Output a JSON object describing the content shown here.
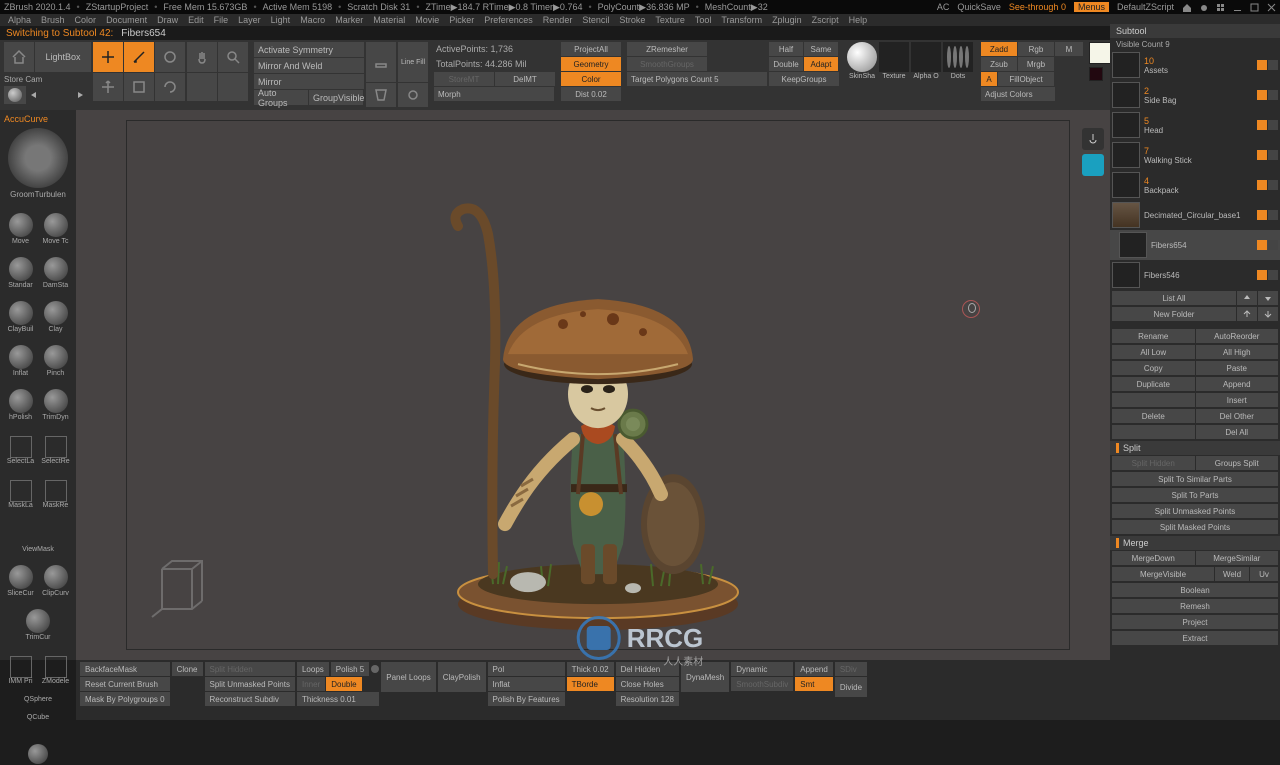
{
  "title": {
    "app": "ZBrush 2020.1.4",
    "project": "ZStartupProject",
    "freemem": "Free Mem 15.673GB",
    "activemem": "Active Mem 5198",
    "scratch": "Scratch Disk 31",
    "ztime": "ZTime▶184.7 RTime▶0.8 Timer▶0.764",
    "polycount": "PolyCount▶36.836 MP",
    "meshcount": "MeshCount▶32",
    "ac": "AC",
    "quicksave": "QuickSave",
    "seethrough": "See-through  0",
    "menus": "Menus",
    "script": "DefaultZScript"
  },
  "menu": {
    "items": [
      "Alpha",
      "Brush",
      "Color",
      "Document",
      "Draw",
      "Edit",
      "File",
      "Layer",
      "Light",
      "Macro",
      "Marker",
      "Material",
      "Movie",
      "Picker",
      "Preferences",
      "Render",
      "Stencil",
      "Stroke",
      "Texture",
      "Tool",
      "Transform",
      "Zplugin",
      "Zscript",
      "Help"
    ]
  },
  "status": {
    "msg": "Switching to Subtool 42:",
    "val": "Fibers654"
  },
  "toolbar": {
    "lightbox": "LightBox",
    "store": "Store Cam",
    "activate_sym": "Activate Symmetry",
    "mirror_weld": "Mirror And Weld",
    "mirror": "Mirror",
    "auto_groups": "Auto Groups",
    "group_visible": "GroupVisible",
    "activepoints": "ActivePoints: 1,736",
    "totalpoints": "TotalPoints: 44.286 Mil",
    "storemt": "StoreMT",
    "delmt": "DelMT",
    "morph": "Morph",
    "project_all": "ProjectAll",
    "geometry": "Geometry",
    "color": "Color",
    "dist": "Dist 0.02",
    "zremesher": "ZRemesher",
    "smoothgroups": "SmoothGroups",
    "target_poly": "Target Polygons Count 5",
    "hhalf": "Half",
    "hsame": "Same",
    "hdouble": "Double",
    "hadapt": "Adapt",
    "keepgroups": "KeepGroups",
    "zadd": "Zadd",
    "zsub": "Zsub",
    "rgb": "Rgb",
    "mrgb": "Mrgb",
    "m": "M",
    "a": "A",
    "fillobject": "FillObject",
    "adjust_colors": "Adjust Colors",
    "skinsha": "SkinSha",
    "texture": "Texture",
    "alphao": "Alpha O",
    "dots": "Dots"
  },
  "left_tools": [
    "Move",
    "Scale",
    "Rotate",
    "Actual"
  ],
  "left": {
    "accu": "AccuCurve",
    "bigbrush": "GroomTurbulen",
    "brushes": [
      "Move",
      "Move Tc",
      "Standar",
      "DamSta",
      "ClayBuil",
      "Clay",
      "Inflat",
      "Pinch",
      "hPolish",
      "TrimDyn",
      "SelectLa",
      "SelectRe",
      "MaskLa",
      "MaskRe",
      "ViewMask",
      "SliceCur",
      "ClipCurv",
      "TrimCur",
      "IMM Pri",
      "ZModele",
      "QSphere",
      "QCube"
    ]
  },
  "right": {
    "subtool": "Subtool",
    "visible": "Visible Count 9",
    "items": [
      {
        "n": "10",
        "name": "Assets"
      },
      {
        "n": "2",
        "name": "Side Bag"
      },
      {
        "n": "5",
        "name": "Head"
      },
      {
        "n": "7",
        "name": "Walking Stick"
      },
      {
        "n": "4",
        "name": "Backpack"
      },
      {
        "n": "",
        "name": "Decimated_Circular_base1"
      },
      {
        "n": "",
        "name": "Fibers654"
      },
      {
        "n": "",
        "name": "Fibers546"
      }
    ],
    "list_all": "List All",
    "new_folder": "New Folder",
    "rename": "Rename",
    "autoreorder": "AutoReorder",
    "all_low": "All Low",
    "all_high": "All High",
    "copy": "Copy",
    "paste": "Paste",
    "duplicate": "Duplicate",
    "append": "Append",
    "insert": "Insert",
    "delete": "Delete",
    "del_other": "Del Other",
    "del_all": "Del All",
    "split": "Split",
    "split_hidden": "Split Hidden",
    "groups_split": "Groups Split",
    "split_similar": "Split To Similar Parts",
    "split_parts": "Split To Parts",
    "split_unmasked": "Split Unmasked Points",
    "split_masked": "Split Masked Points",
    "merge": "Merge",
    "merge_down": "MergeDown",
    "merge_similar": "MergeSimilar",
    "merge_visible": "MergeVisible",
    "weld": "Weld",
    "uv": "Uv",
    "boolean": "Boolean",
    "remesh": "Remesh",
    "project": "Project",
    "extract": "Extract"
  },
  "bottom": {
    "backface": "BackfaceMask",
    "clone": "Clone",
    "reset": "Reset Current Brush",
    "maskpoly": "Mask By Polygroups 0",
    "split_hidden": "Split Hidden",
    "split_unmasked": "Split Unmasked Points",
    "reconstruct": "Reconstruct Subdiv",
    "loops": "Loops",
    "polish": "Polish 5",
    "panel_loops": "Panel Loops",
    "inner": "Inner",
    "double": "Double",
    "thickness": "Thickness 0.01",
    "claypolish": "ClayPolish",
    "pol": "Pol",
    "inflat": "Inflat",
    "polish_feat": "Polish By Features",
    "thick": "Thick 0.02",
    "tborde": "TBorde",
    "del_hidden": "Del Hidden",
    "close_holes": "Close Holes",
    "res": "Resolution 128",
    "dynamesh": "DynaMesh",
    "dynamic": "Dynamic",
    "smoothsubdiv": "SmoothSubdiv",
    "append": "Append",
    "smt": "Smt",
    "sdiv": "SDiv",
    "divide": "Divide"
  }
}
